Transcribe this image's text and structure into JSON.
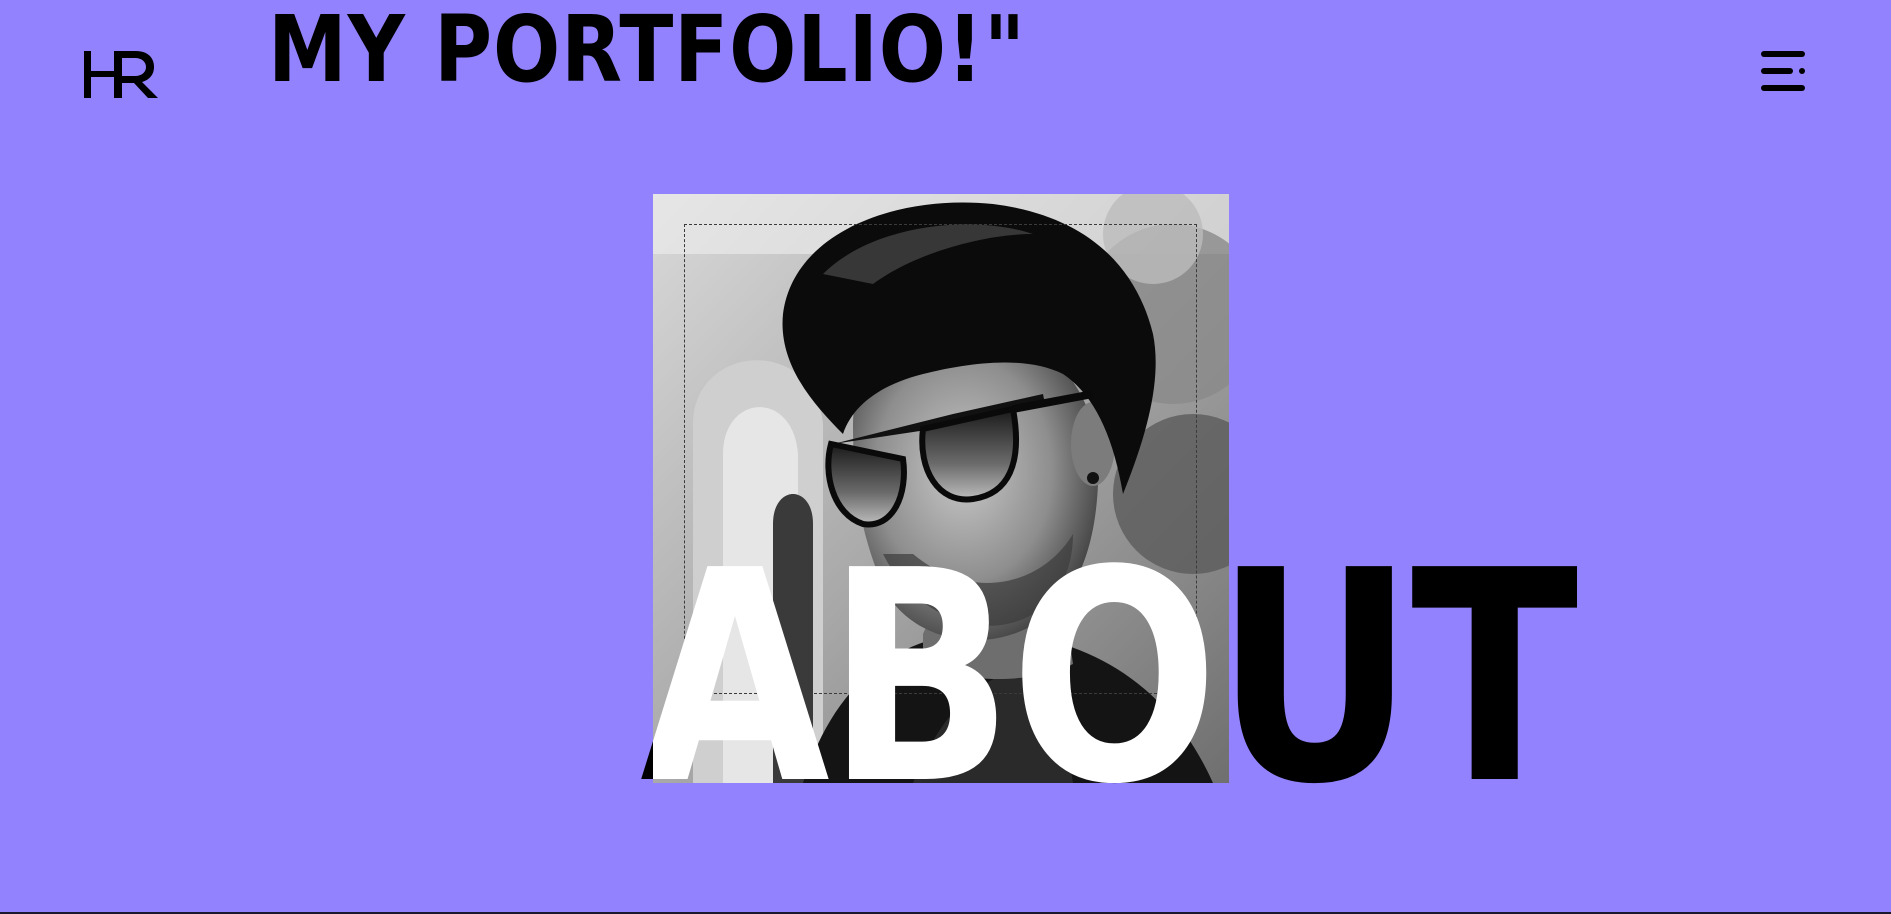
{
  "header": {
    "logo_text": "HR",
    "title": "MY  PORTFOLIO!\""
  },
  "menu": {
    "icon": "hamburger-menu-icon"
  },
  "hero": {
    "photo_alt": "black and white portrait of a man with sunglasses",
    "word": "ABOUT"
  },
  "colors": {
    "background": "#9282fd",
    "text": "#000000",
    "overlay_text": "#ffffff"
  }
}
